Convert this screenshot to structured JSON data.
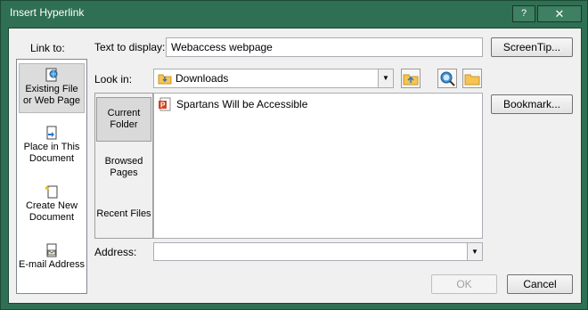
{
  "window": {
    "title": "Insert Hyperlink",
    "help_label": "?",
    "close_label": "✕"
  },
  "link_to": {
    "label": "Link to:",
    "items": [
      {
        "label": "Existing File or Web Page",
        "icon": "web-page-icon",
        "selected": true
      },
      {
        "label": "Place in This Document",
        "icon": "document-place-icon",
        "selected": false
      },
      {
        "label": "Create New Document",
        "icon": "new-document-icon",
        "selected": false
      },
      {
        "label": "E-mail Address",
        "icon": "email-icon",
        "selected": false
      }
    ]
  },
  "text_to_display": {
    "label": "Text to display:",
    "value": "Webaccess webpage"
  },
  "screentip_label": "ScreenTip...",
  "look_in": {
    "label": "Look in:",
    "value": "Downloads"
  },
  "side_buttons": [
    {
      "label": "Current Folder",
      "selected": true
    },
    {
      "label": "Browsed Pages",
      "selected": false
    },
    {
      "label": "Recent Files",
      "selected": false
    }
  ],
  "files": [
    {
      "name": "Spartans Will be Accessible",
      "icon": "powerpoint-file-icon"
    }
  ],
  "bookmark_label": "Bookmark...",
  "address": {
    "label": "Address:",
    "value": ""
  },
  "ok_label": "OK",
  "cancel_label": "Cancel",
  "colors": {
    "window_frame": "#2f6f53",
    "dialog_bg": "#f0f0f0",
    "powerpoint": "#d04423"
  }
}
